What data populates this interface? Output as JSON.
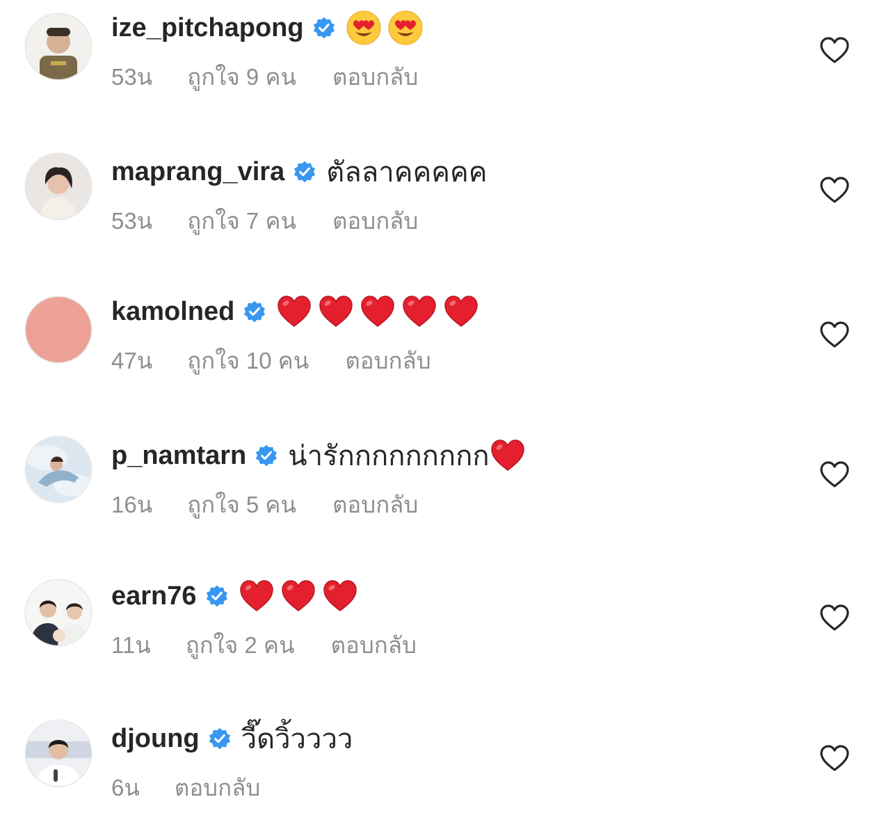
{
  "comments": [
    {
      "username": "ize_pitchapong",
      "text": "",
      "emojis": [
        "heart-eyes-emoji",
        "heart-eyes-emoji"
      ],
      "time": "53น",
      "likes": "ถูกใจ 9 คน",
      "reply": "ตอบกลับ"
    },
    {
      "username": "maprang_vira",
      "text": "ตัลลาคคคคค",
      "emojis": [],
      "time": "53น",
      "likes": "ถูกใจ 7 คน",
      "reply": "ตอบกลับ"
    },
    {
      "username": "kamolned",
      "text": "",
      "emojis": [
        "red-heart-emoji",
        "red-heart-emoji",
        "red-heart-emoji",
        "red-heart-emoji",
        "red-heart-emoji"
      ],
      "time": "47น",
      "likes": "ถูกใจ 10 คน",
      "reply": "ตอบกลับ"
    },
    {
      "username": "p_namtarn",
      "text": "น่ารักกกกกกกกก",
      "emojis": [
        "red-heart-emoji"
      ],
      "time": "16น",
      "likes": "ถูกใจ 5 คน",
      "reply": "ตอบกลับ"
    },
    {
      "username": "earn76",
      "text": "",
      "emojis": [
        "red-heart-emoji",
        "red-heart-emoji",
        "red-heart-emoji"
      ],
      "time": "11น",
      "likes": "ถูกใจ 2 คน",
      "reply": "ตอบกลับ"
    },
    {
      "username": "djoung",
      "text": "วี๊ดวิ้วววว",
      "emojis": [],
      "time": "6น",
      "likes": "",
      "reply": "ตอบกลับ"
    }
  ],
  "icons": {
    "verified": "verified-badge-icon",
    "like": "heart-outline-icon"
  },
  "colors": {
    "verified_blue": "#3897f0",
    "meta_gray": "#8e8e8e",
    "text": "#262626",
    "kamolned_avatar": "#eda196"
  }
}
